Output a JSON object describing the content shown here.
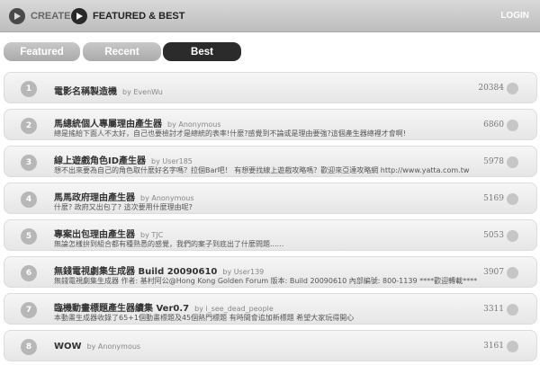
{
  "topnav": {
    "create_label": "CREATE",
    "featured_label": "FEATURED & BEST",
    "login_label": "LOGIN"
  },
  "tabs": [
    {
      "label": "Featured",
      "active": false
    },
    {
      "label": "Recent",
      "active": false
    },
    {
      "label": "Best",
      "active": true
    }
  ],
  "items": [
    {
      "rank": "1",
      "title": "電影名稱製造機",
      "author": "by EvenWu",
      "desc": "",
      "count": "20384"
    },
    {
      "rank": "2",
      "title": "馬總統個人專屬理由產生器",
      "author": "by Anonymous",
      "desc": "總是搖給下面人不太好，自己也要檢討才是總統的表率!什麼?感覺到不論或是理由要強?這個產生器總裡才會啊!",
      "count": "6860"
    },
    {
      "rank": "3",
      "title": "線上遊戲角色ID產生器",
      "author": "by User185",
      "desc": "想不出來要為自己的角色取什麼好名字嗎？拉個Bar吧！ 有想要找線上遊戲攻略嗎？歡迎來亞達攻略網 http://www.yatta.com.tw",
      "count": "5978"
    },
    {
      "rank": "4",
      "title": "馬馬政府理由產生器",
      "author": "by Anonymous",
      "desc": "什麼? 政府又出包了? 這次要用什麼理由呢?",
      "count": "5169"
    },
    {
      "rank": "5",
      "title": "專案出包理由產生器",
      "author": "by TJC",
      "desc": "無論怎樣拚到組合都有種熟悉的感覺，我們的案子到底出了什麼問題......",
      "count": "5053"
    },
    {
      "rank": "6",
      "title": "無錢電視劇集生成器 Build 20090610",
      "author": "by User139",
      "desc": "無錢電視劇集生成器 作者: 基村阿公@Hong Kong Golden Forum 版本: Build 20090610 內部編號: 800-1139 ****歡迎轉載****",
      "count": "3907"
    },
    {
      "rank": "7",
      "title": "臨機動畫標題產生器續集 Ver0.7",
      "author": "by i_see_dead_people",
      "desc": "本動畫生成器收錄了65+1個動畫標題及45個熱門標題 有時間會追加新標題 希望大家玩得開心",
      "count": "3311"
    },
    {
      "rank": "8",
      "title": "WOW",
      "author": "by Anonymous",
      "desc": "",
      "count": "3161"
    }
  ]
}
